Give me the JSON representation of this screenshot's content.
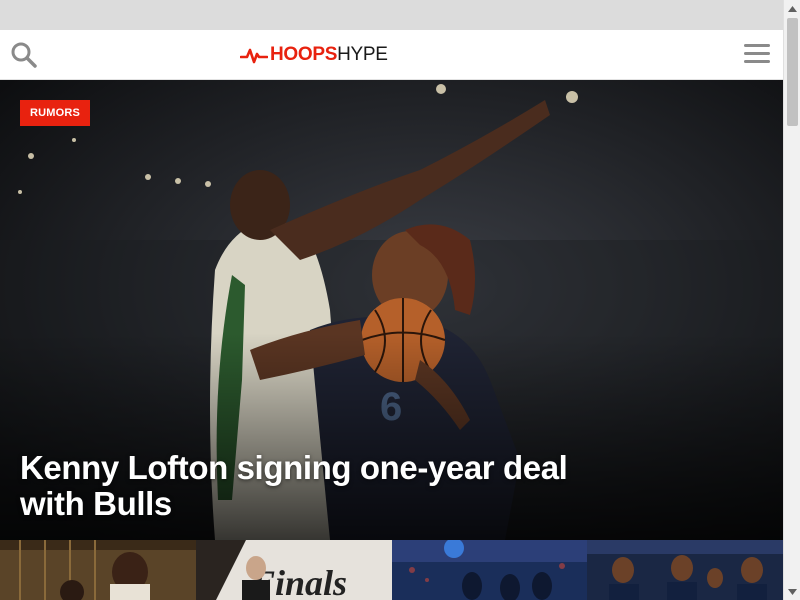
{
  "header": {
    "logo_bold": "HOOPS",
    "logo_light": "HYPE",
    "search_icon": "search-icon",
    "menu_icon": "hamburger-menu-icon"
  },
  "hero": {
    "tag": "RUMORS",
    "headline": "Kenny Lofton signing one-year deal with Bulls"
  },
  "thumbnails": [
    {
      "icon": "photo-thumbnail"
    },
    {
      "icon": "photo-thumbnail"
    },
    {
      "icon": "photo-thumbnail"
    },
    {
      "icon": "photo-thumbnail"
    }
  ],
  "colors": {
    "brand_red": "#e8220f",
    "header_bg": "#ffffff",
    "icon_gray": "#8a8a8a"
  }
}
